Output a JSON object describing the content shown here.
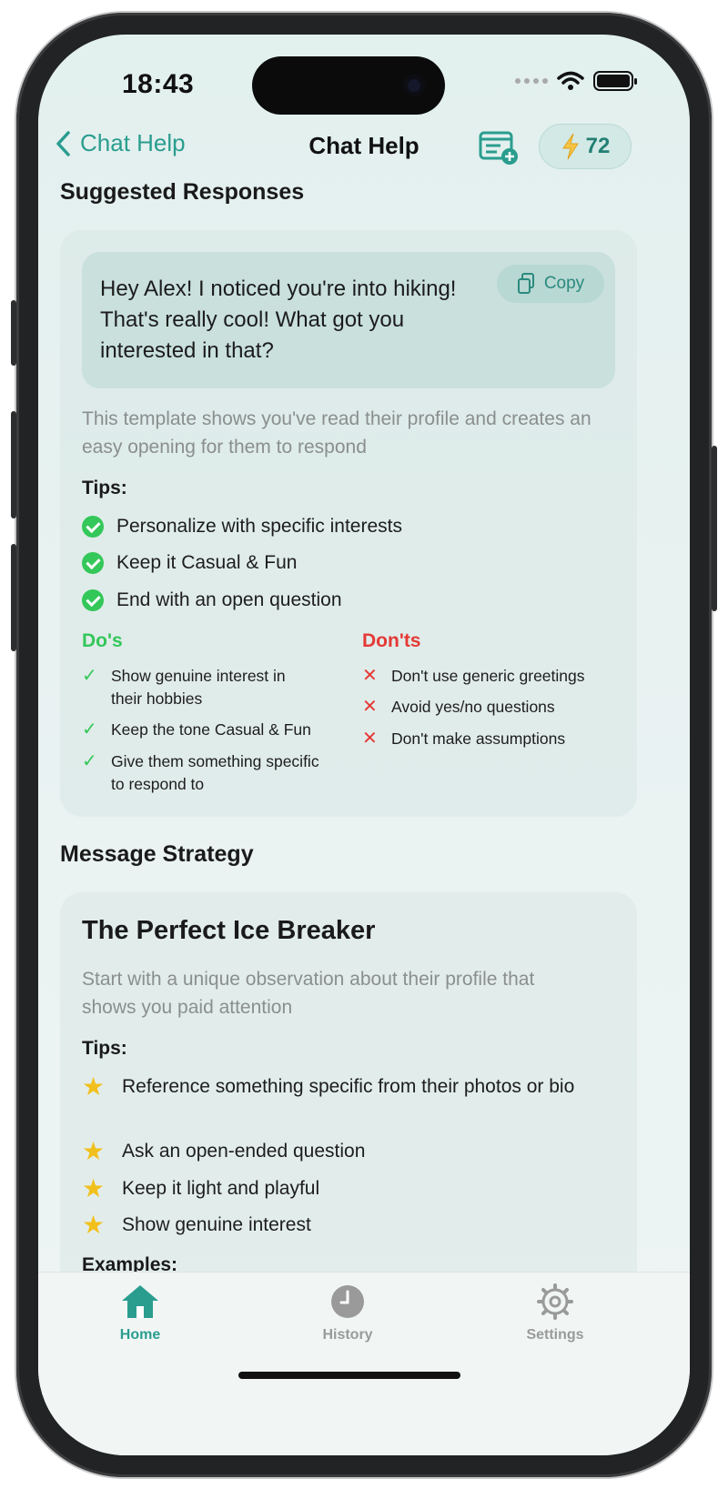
{
  "status_bar": {
    "time": "18:43"
  },
  "nav": {
    "back_label": "Chat Help",
    "title": "Chat Help",
    "credits": "72"
  },
  "suggested": {
    "section_title": "Suggested Responses",
    "message": "Hey Alex! I noticed you're into hiking! That's really cool! What got you interested in that?",
    "copy_label": "Copy",
    "description": "This template shows you've read their profile and creates an easy opening for them to respond",
    "tips_label": "Tips:",
    "tips": [
      "Personalize with specific interests",
      "Keep it Casual & Fun",
      "End with an open question"
    ],
    "dos_title": "Do's",
    "dos": [
      "Show genuine interest in their hobbies",
      "Keep the tone Casual & Fun",
      "Give them something specific to respond to"
    ],
    "donts_title": "Don'ts",
    "donts": [
      "Don't use generic greetings",
      "Avoid yes/no questions",
      "Don't make assumptions"
    ]
  },
  "strategy": {
    "section_title": "Message Strategy",
    "card_title": "The Perfect Ice Breaker",
    "description": "Start with a unique observation about their profile that shows you paid attention",
    "tips_label": "Tips:",
    "tips": [
      "Reference something specific from their photos or bio",
      "Ask an open-ended question",
      "Keep it light and playful",
      "Show genuine interest"
    ],
    "examples_label": "Examples:"
  },
  "tabs": [
    {
      "label": "Home",
      "icon": "home-icon",
      "active": true
    },
    {
      "label": "History",
      "icon": "clock-icon",
      "active": false
    },
    {
      "label": "Settings",
      "icon": "gear-icon",
      "active": false
    }
  ],
  "colors": {
    "accent": "#2a9d8f",
    "do_green": "#34c759",
    "dont_red": "#e53935",
    "star": "#f2c01c"
  }
}
